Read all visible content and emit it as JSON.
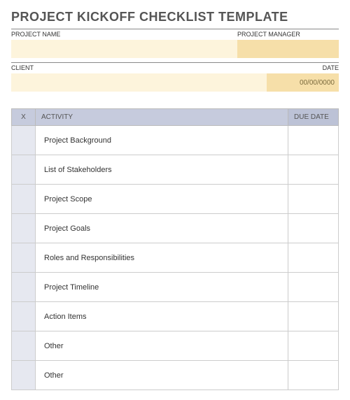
{
  "title": "PROJECT KICKOFF CHECKLIST TEMPLATE",
  "meta": {
    "project_name_label": "PROJECT NAME",
    "project_manager_label": "PROJECT MANAGER",
    "client_label": "CLIENT",
    "date_label": "DATE",
    "project_name_value": "",
    "project_manager_value": "",
    "client_value": "",
    "date_value": "00/00/0000"
  },
  "table": {
    "headers": {
      "x": "X",
      "activity": "ACTIVITY",
      "due_date": "DUE DATE"
    },
    "rows": [
      {
        "x": "",
        "activity": "Project Background",
        "due_date": ""
      },
      {
        "x": "",
        "activity": "List of Stakeholders",
        "due_date": ""
      },
      {
        "x": "",
        "activity": "Project Scope",
        "due_date": ""
      },
      {
        "x": "",
        "activity": "Project Goals",
        "due_date": ""
      },
      {
        "x": "",
        "activity": "Roles and Responsibilities",
        "due_date": ""
      },
      {
        "x": "",
        "activity": "Project Timeline",
        "due_date": ""
      },
      {
        "x": "",
        "activity": "Action Items",
        "due_date": ""
      },
      {
        "x": "",
        "activity": "Other",
        "due_date": ""
      },
      {
        "x": "",
        "activity": "Other",
        "due_date": ""
      }
    ]
  }
}
